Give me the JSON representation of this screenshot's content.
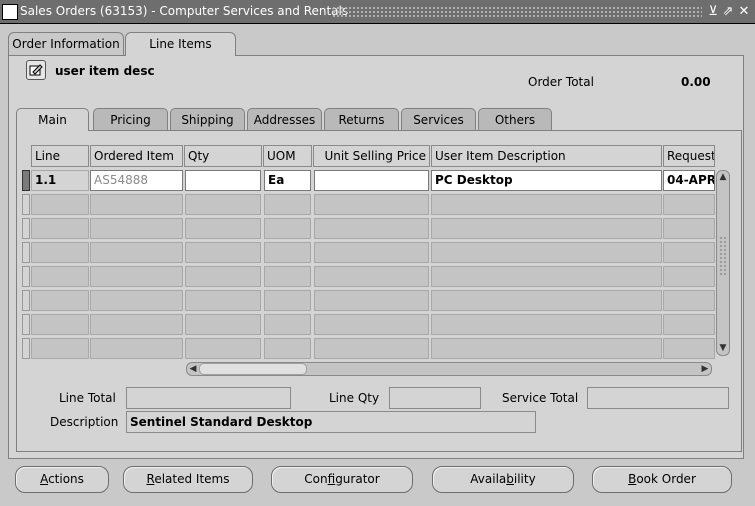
{
  "window": {
    "title": "Sales Orders (63153) - Computer Services and Rentals",
    "min_glyph": "⊻",
    "max_glyph": "⇗",
    "close_glyph": "✕"
  },
  "top_tabs": [
    {
      "label": "Order Information",
      "active": false
    },
    {
      "label": "Line Items",
      "active": true
    }
  ],
  "header": {
    "folder_label": "user item desc",
    "order_total_label": "Order Total",
    "order_total_value": "0.00"
  },
  "inner_tabs": [
    {
      "label": "Main",
      "active": true
    },
    {
      "label": "Pricing"
    },
    {
      "label": "Shipping"
    },
    {
      "label": "Addresses"
    },
    {
      "label": "Returns"
    },
    {
      "label": "Services"
    },
    {
      "label": "Others"
    }
  ],
  "grid": {
    "columns": [
      "Line",
      "Ordered Item",
      "Qty",
      "UOM",
      "Unit Selling Price",
      "User Item Description",
      "Request"
    ],
    "rows": [
      {
        "line": "1.1",
        "ordered_item": "AS54888",
        "qty": "",
        "uom": "Ea",
        "unit_selling_price": "",
        "user_item_description": "PC Desktop",
        "request": "04-APR"
      }
    ]
  },
  "totals": {
    "line_total_label": "Line Total",
    "line_total_value": "",
    "line_qty_label": "Line Qty",
    "line_qty_value": "",
    "service_total_label": "Service Total",
    "service_total_value": "",
    "description_label": "Description",
    "description_value": "Sentinel Standard Desktop"
  },
  "buttons": [
    {
      "pre": "",
      "ul": "A",
      "post": "ctions"
    },
    {
      "pre": "",
      "ul": "R",
      "post": "elated Items"
    },
    {
      "pre": "Con",
      "ul": "f",
      "post": "igurator"
    },
    {
      "pre": "Availa",
      "ul": "b",
      "post": "ility"
    },
    {
      "pre": "",
      "ul": "B",
      "post": "ook Order"
    }
  ],
  "colors": {
    "titlebar": "#6e6e6e",
    "background": "#c9c9c9",
    "panel": "#d4d4d4"
  }
}
